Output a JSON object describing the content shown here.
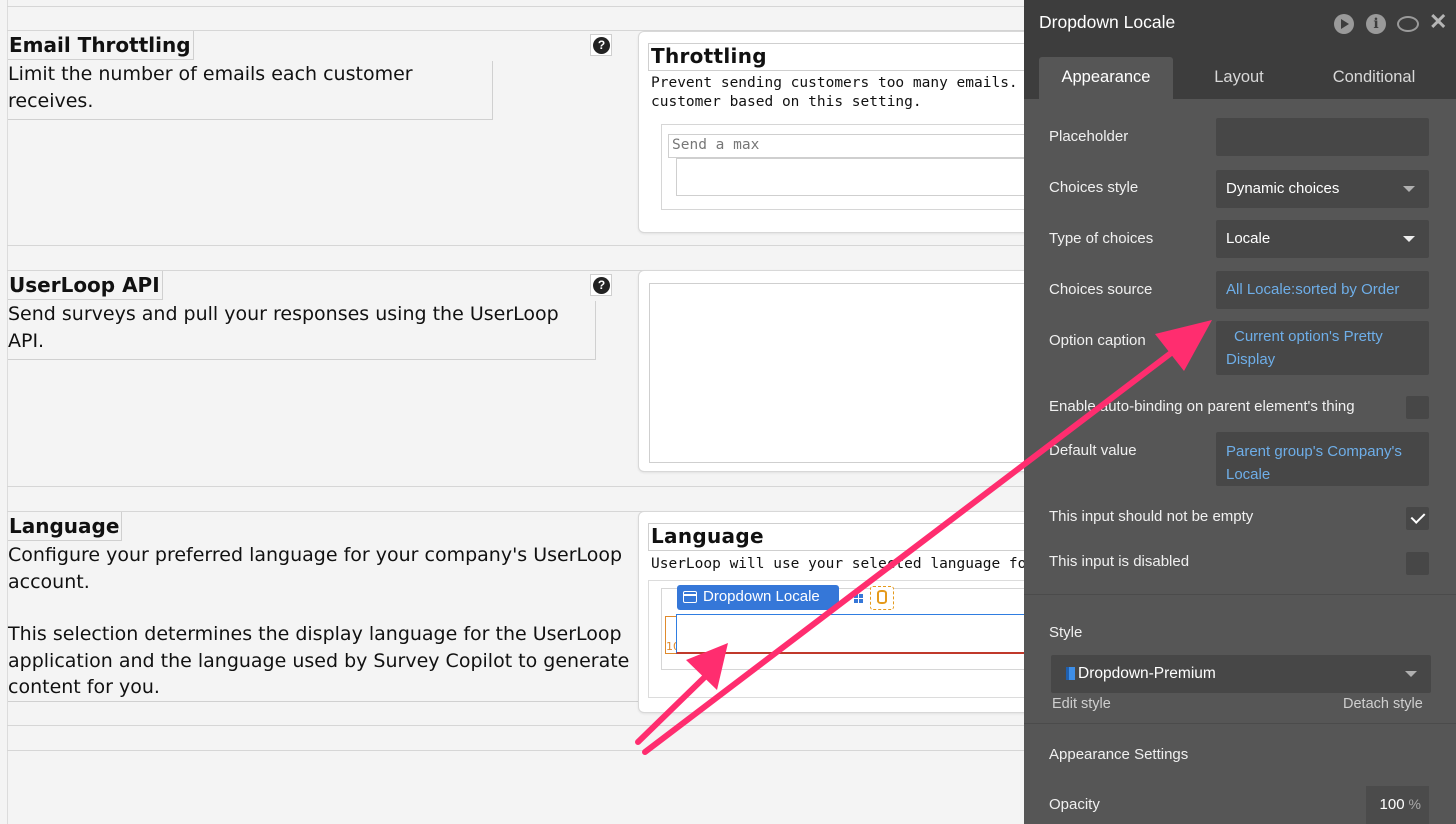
{
  "sections": [
    {
      "title": "Email Throttling",
      "desc": "Limit the number of emails each customer receives."
    },
    {
      "title": "UserLoop API",
      "desc": "Send surveys and pull your responses using the UserLoop API."
    },
    {
      "title": "Language",
      "desc1": "Configure your preferred language for your company's UserLoop account.",
      "desc2": "This selection determines the display language for the UserLoop application and the language used by Survey Copilot to generate content for you."
    }
  ],
  "cards": {
    "throttling": {
      "title": "Throttling",
      "desc_line1": "Prevent sending customers too many emails.  We",
      "desc_line2": "customer based on this setting.",
      "placeholder": "Send a max"
    },
    "language": {
      "title": "Language",
      "desc_line1": "UserLoop will use your selected language for Su",
      "tag": "Dropdown Locale"
    }
  },
  "panel": {
    "title": "Dropdown Locale",
    "tabs": [
      "Appearance",
      "Layout",
      "Conditional"
    ],
    "active_tab": "Appearance",
    "placeholder_label": "Placeholder",
    "placeholder_value": "",
    "choices_style_label": "Choices style",
    "choices_style_value": "Dynamic choices",
    "type_label": "Type of choices",
    "type_value": "Locale",
    "source_label": "Choices source",
    "source_value": "All Locale:sorted by Order",
    "caption_label": "Option caption",
    "caption_line1": "Current option's Pretty",
    "caption_line2": "Display",
    "autobind_label": "Enable auto-binding on parent element's thing",
    "default_label": "Default value",
    "default_line1": "Parent group's Company's",
    "default_line2": "Locale",
    "not_empty_label": "This input should not be empty",
    "not_empty_checked": true,
    "disabled_label": "This input is disabled",
    "disabled_checked": false,
    "style_label": "Style",
    "style_value": "Dropdown-Premium",
    "edit_style": "Edit style",
    "detach_style": "Detach style",
    "appearance_settings": "Appearance Settings",
    "opacity_label": "Opacity",
    "opacity_value": "100",
    "opacity_unit": "%"
  },
  "colors": {
    "arrow": "#ff2d6f",
    "panel_bg": "#565656",
    "header_bg": "#3d3d3d",
    "link": "#6eaee8",
    "tag": "#3577d8"
  },
  "icons": [
    "play-icon",
    "info-icon",
    "comment-icon",
    "close-icon",
    "help-icon",
    "group-icon",
    "database-icon"
  ]
}
